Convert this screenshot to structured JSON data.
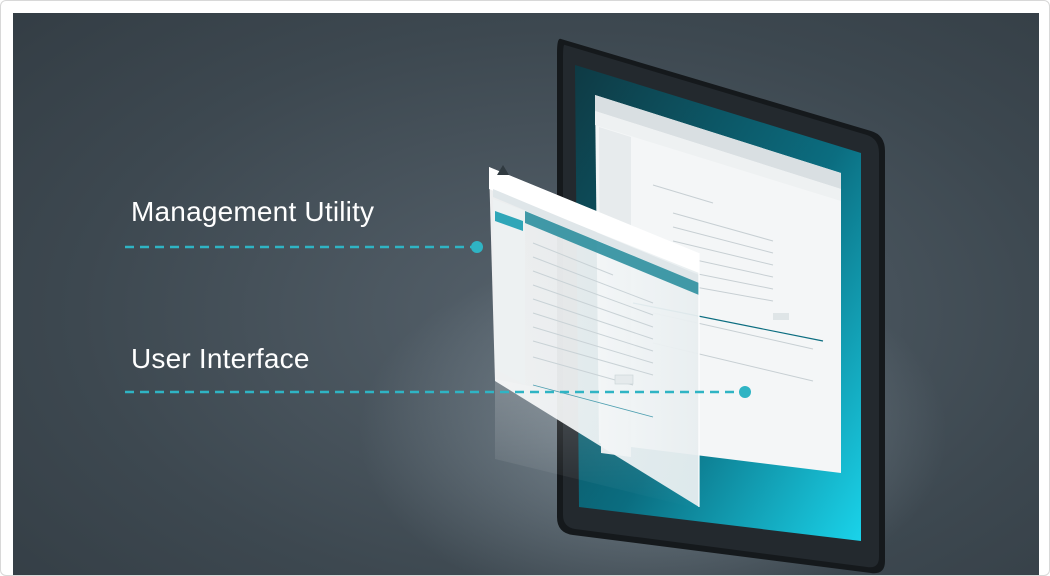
{
  "callouts": {
    "management_utility": "Management Utility",
    "user_interface": "User Interface"
  },
  "colors": {
    "accent": "#2fb4c4",
    "background": "#3d4850",
    "tablet_bezel": "#1b2024"
  }
}
